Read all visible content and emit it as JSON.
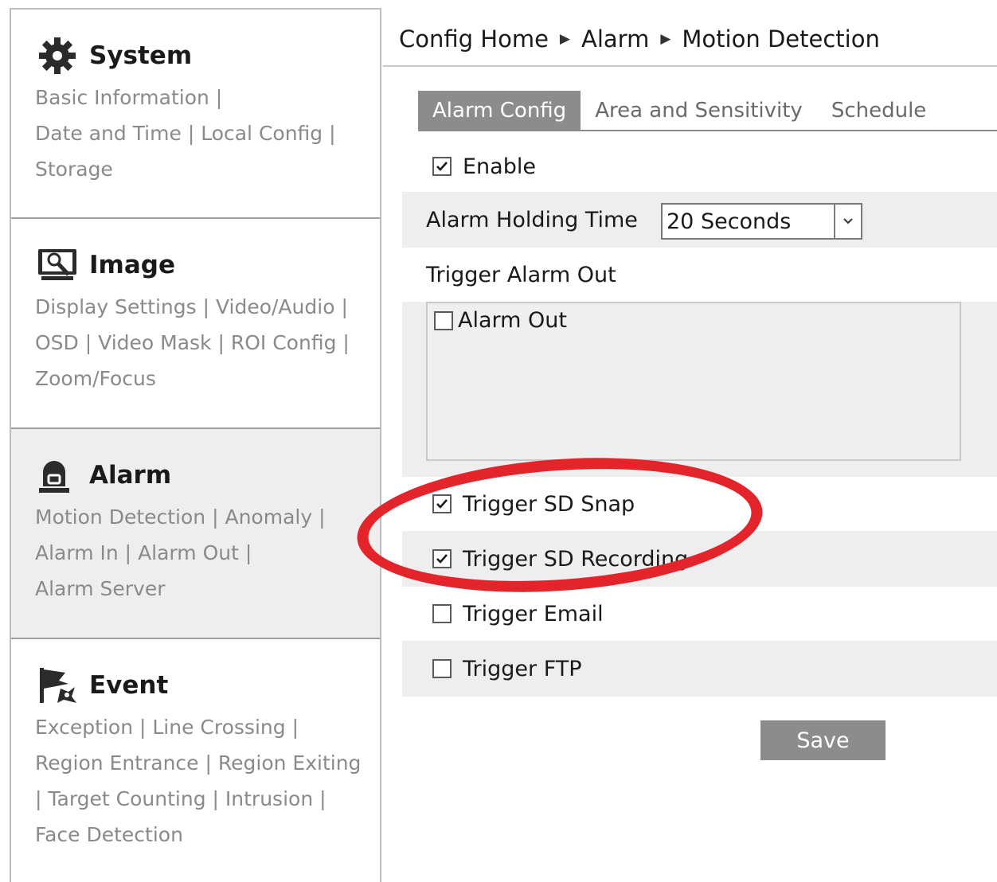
{
  "sidebar": {
    "system": {
      "title": "System",
      "icon": "gear-icon",
      "links": [
        "Basic Information",
        "Date and Time",
        "Local Config",
        "Storage"
      ]
    },
    "image": {
      "title": "Image",
      "icon": "monitor-icon",
      "links": [
        "Display Settings",
        "Video/Audio",
        "OSD",
        "Video Mask",
        "ROI Config",
        "Zoom/Focus"
      ]
    },
    "alarm": {
      "title": "Alarm",
      "icon": "alarm-light-icon",
      "links": [
        "Motion Detection",
        "Anomaly",
        "Alarm In",
        "Alarm Out",
        "Alarm Server"
      ]
    },
    "event": {
      "title": "Event",
      "icon": "event-flag-icon",
      "links": [
        "Exception",
        "Line Crossing",
        "Region Entrance",
        "Region Exiting",
        "Target Counting",
        "Intrusion",
        "Face Detection"
      ]
    }
  },
  "breadcrumb": [
    "Config Home",
    "Alarm",
    "Motion Detection"
  ],
  "tabs": [
    "Alarm Config",
    "Area and Sensitivity",
    "Schedule"
  ],
  "form": {
    "enable": {
      "label": "Enable",
      "checked": true
    },
    "holding_time": {
      "label": "Alarm Holding Time",
      "value": "20 Seconds"
    },
    "trigger_alarm_out_label": "Trigger Alarm Out",
    "alarm_out": {
      "label": "Alarm Out",
      "checked": false
    },
    "sd_snap": {
      "label": "Trigger SD Snap",
      "checked": true
    },
    "sd_recording": {
      "label": "Trigger SD Recording",
      "checked": true
    },
    "email": {
      "label": "Trigger Email",
      "checked": false
    },
    "ftp": {
      "label": "Trigger FTP",
      "checked": false
    },
    "save_label": "Save"
  },
  "colors": {
    "accent_gray": "#8c8c8c",
    "highlight_red": "#e3242b",
    "link_gray": "#8a8a8a"
  }
}
